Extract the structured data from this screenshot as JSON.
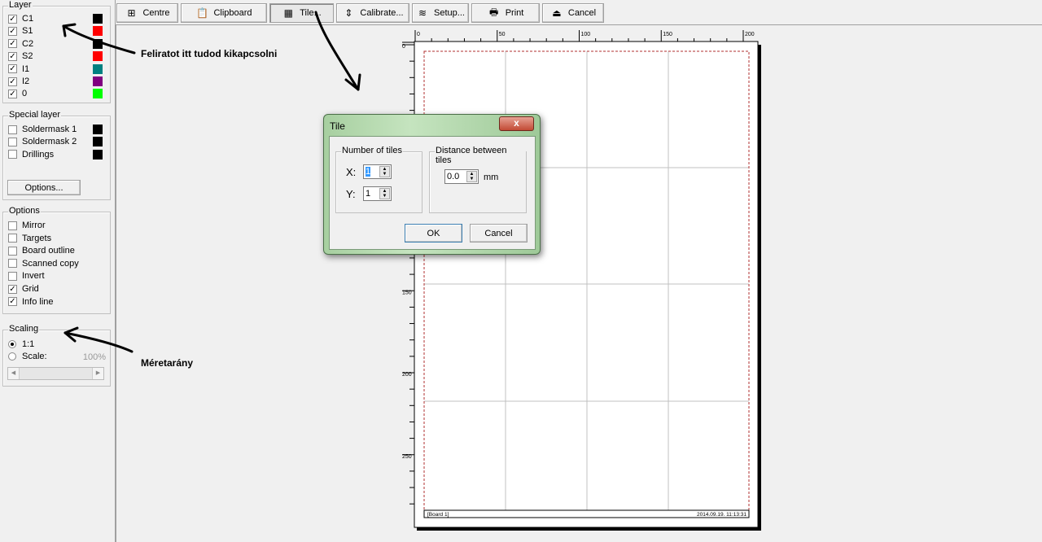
{
  "sidebar": {
    "layer": {
      "title": "Layer",
      "items": [
        {
          "label": "C1",
          "checked": true,
          "color": "#000000"
        },
        {
          "label": "S1",
          "checked": true,
          "color": "#ff0000"
        },
        {
          "label": "C2",
          "checked": true,
          "color": "#000000"
        },
        {
          "label": "S2",
          "checked": true,
          "color": "#ff0000"
        },
        {
          "label": "I1",
          "checked": true,
          "color": "#008080"
        },
        {
          "label": "I2",
          "checked": true,
          "color": "#800080"
        },
        {
          "label": "0",
          "checked": true,
          "color": "#00ff00"
        }
      ]
    },
    "special": {
      "title": "Special layer",
      "items": [
        {
          "label": "Soldermask 1",
          "checked": false,
          "color": "#000000"
        },
        {
          "label": "Soldermask 2",
          "checked": false,
          "color": "#000000"
        },
        {
          "label": "Drillings",
          "checked": false,
          "color": "#000000"
        }
      ],
      "options_button": "Options..."
    },
    "options": {
      "title": "Options",
      "items": [
        {
          "label": "Mirror",
          "checked": false
        },
        {
          "label": "Targets",
          "checked": false
        },
        {
          "label": "Board outline",
          "checked": false
        },
        {
          "label": "Scanned copy",
          "checked": false
        },
        {
          "label": "Invert",
          "checked": false
        },
        {
          "label": "Grid",
          "checked": true
        },
        {
          "label": "Info line",
          "checked": true
        }
      ]
    },
    "scaling": {
      "title": "Scaling",
      "opt1": "1:1",
      "opt2": "Scale:",
      "value": "100%",
      "selected": "1:1"
    }
  },
  "toolbar": [
    {
      "label": "Centre",
      "icon": "centre-icon"
    },
    {
      "label": "Clipboard",
      "icon": "clipboard-icon"
    },
    {
      "label": "Tile...",
      "icon": "tile-icon",
      "pressed": true
    },
    {
      "label": "Calibrate...",
      "icon": "calibrate-icon"
    },
    {
      "label": "Setup...",
      "icon": "setup-icon"
    },
    {
      "label": "Print",
      "icon": "printer-icon"
    },
    {
      "label": "Cancel",
      "icon": "cancel-icon"
    }
  ],
  "ruler": {
    "h_ticks": [
      "0",
      "50",
      "100",
      "150",
      "200"
    ],
    "v_ticks": [
      "0",
      "150",
      "200",
      "250"
    ]
  },
  "page": {
    "info_left": "[Board 1]",
    "info_right": "2014.09.19. 11:13:31"
  },
  "annotations": {
    "a1": "Feliratot itt tudod kikapcsolni",
    "a2": "Méretarány"
  },
  "dialog": {
    "title": "Tile",
    "close": "x",
    "tiles_group": "Number of tiles",
    "x_label": "X:",
    "x_value": "1",
    "y_label": "Y:",
    "y_value": "1",
    "dist_group": "Distance between tiles",
    "dist_value": "0.0",
    "unit": "mm",
    "ok": "OK",
    "cancel": "Cancel"
  }
}
